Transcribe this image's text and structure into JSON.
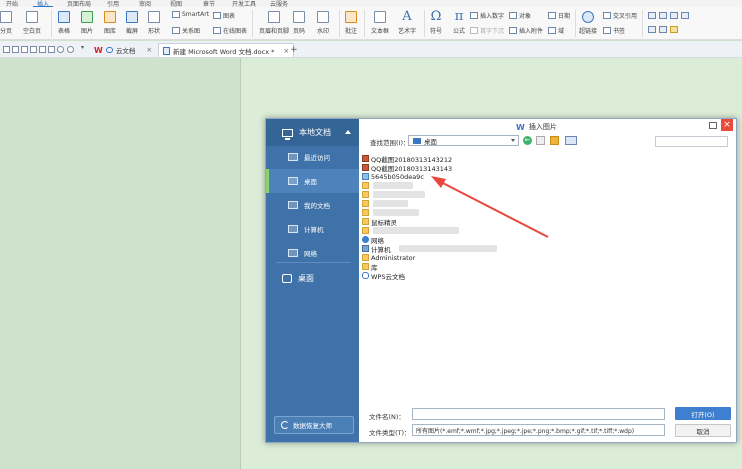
{
  "menu_tabs": [
    {
      "label": "开始"
    },
    {
      "label": "插入",
      "active": true
    },
    {
      "label": "页面布局"
    },
    {
      "label": "引用"
    },
    {
      "label": "审阅"
    },
    {
      "label": "视图"
    },
    {
      "label": "章节"
    },
    {
      "label": "开发工具"
    },
    {
      "label": "云服务"
    }
  ],
  "ribbon": {
    "page_break": "分页",
    "blank_page": "空白页",
    "table": "表格",
    "picture": "图片",
    "gallery": "图库",
    "screenshot": "截屏",
    "shapes": "形状",
    "smartart": "SmartArt",
    "chart": "图表",
    "relation_chart": "关系图",
    "online_chart": "在线图表",
    "header_footer": "页眉和页脚",
    "page_number": "页码",
    "watermark": "水印",
    "comment": "批注",
    "textbox": "文本框",
    "wordart": "艺术字",
    "symbol": "符号",
    "formula": "公式",
    "insert_number": "插入数字",
    "object": "对象",
    "first_drop": "首字下沉",
    "insert_attachment": "插入附件",
    "date": "日期",
    "field": "域",
    "hyperlink": "超链接",
    "cross_ref": "交叉引用",
    "bookmark": "书签"
  },
  "tabs": {
    "cloud_docs": "云文档",
    "active_doc": "新建 Microsoft Word 文档.docx *",
    "add": "+"
  },
  "dialog": {
    "title": "插入图片",
    "close": "×",
    "sidebar": {
      "header": "本地文档",
      "items": [
        {
          "label": "最近访问"
        },
        {
          "label": "桌面",
          "active": true
        },
        {
          "label": "我的文档"
        },
        {
          "label": "计算机"
        },
        {
          "label": "网络"
        }
      ],
      "cloud": "桌面",
      "recover": "数据恢复大师"
    },
    "look_in_label": "查找范围(I)：",
    "look_in_value": "桌面",
    "files": [
      {
        "name": "QQ截图20180313143212",
        "icon": "image-file-icon"
      },
      {
        "name": "QQ截图20180313143143",
        "icon": "image-file-icon"
      },
      {
        "name": "5645b050dea9c",
        "icon": "picture-file-icon"
      },
      {
        "name": "",
        "icon": "folder-icon"
      },
      {
        "name": "",
        "icon": "folder-icon"
      },
      {
        "name": "",
        "icon": "folder-icon"
      },
      {
        "name": "",
        "icon": "folder-icon"
      },
      {
        "name": "鼠标精灵",
        "icon": "folder-icon"
      },
      {
        "name": "",
        "icon": "folder-icon"
      },
      {
        "name": "网络",
        "icon": "network-icon"
      },
      {
        "name": "计算机",
        "icon": "computer-icon"
      },
      {
        "name": "Administrator",
        "icon": "user-folder-icon"
      },
      {
        "name": "库",
        "icon": "library-folder-icon"
      },
      {
        "name": "WPS云文档",
        "icon": "cloud-icon"
      }
    ],
    "filename_label": "文件名(N)：",
    "filename_value": "",
    "filetype_label": "文件类型(T)：",
    "filetype_value": "所有图片(*.emf;*.wmf;*.jpg;*.jpeg;*.jpe;*.png;*.bmp;*.gif;*.tif;*.tiff;*.wdp)",
    "open_button": "打开(O)",
    "cancel_button": "取消"
  },
  "colors": {
    "sidebar": "#3f72a8",
    "accent": "#3f7fd0",
    "close": "#e84a3b",
    "doc_bg": "#cfe3cc",
    "arrow": "#e8473d"
  }
}
